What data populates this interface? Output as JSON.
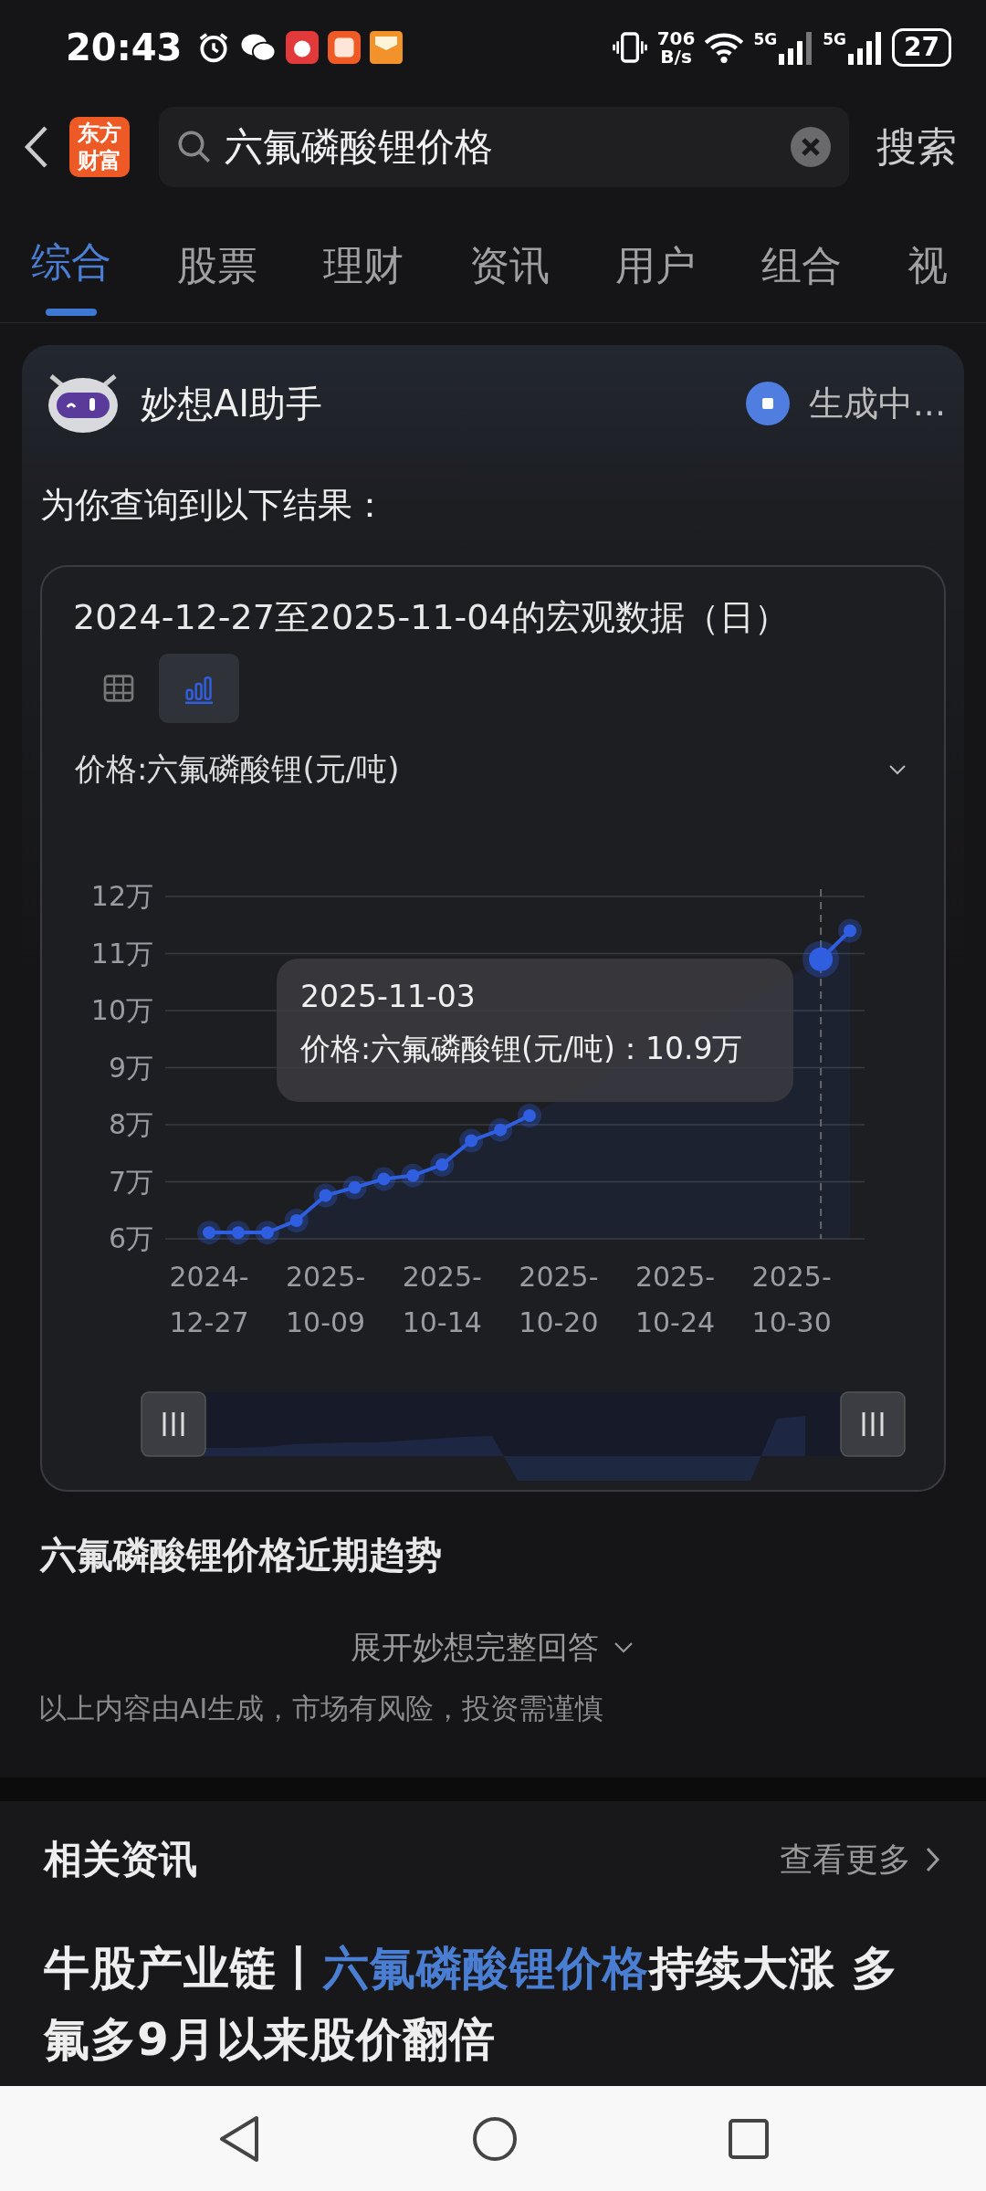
{
  "status_bar": {
    "time": "20:43",
    "net_speed": "706\nB/s",
    "signal_1": "5G",
    "signal_2": "5G",
    "battery": "27"
  },
  "header": {
    "logo": "东方财富",
    "search": {
      "value": "六氟磷酸锂价格"
    },
    "search_button": "搜索"
  },
  "tabs": [
    {
      "label": "综合",
      "selected": true
    },
    {
      "label": "股票",
      "selected": false
    },
    {
      "label": "理财",
      "selected": false
    },
    {
      "label": "资讯",
      "selected": false
    },
    {
      "label": "用户",
      "selected": false
    },
    {
      "label": "组合",
      "selected": false
    },
    {
      "label": "视",
      "selected": false
    }
  ],
  "ai_card": {
    "title": "妙想AI助手",
    "status": "生成中...",
    "intro": "为你查询到以下结果：",
    "data_card": {
      "title": "2024-12-27至2025-11-04的宏观数据（日）",
      "view_toggle": [
        {
          "kind": "table",
          "selected": false
        },
        {
          "kind": "chart",
          "selected": true
        }
      ],
      "tooltip": {
        "date": "2025-11-03",
        "label": "价格:六氟磷酸锂(元/吨)：",
        "value": "10.9万"
      },
      "chart_data": {
        "type": "area",
        "grid": true,
        "categories": [
          "2024-12-27",
          null,
          null,
          null,
          "2025-10-09",
          null,
          null,
          null,
          "2025-10-14",
          null,
          null,
          null,
          "2025-10-20",
          null,
          null,
          null,
          "2025-10-24",
          null,
          null,
          null,
          "2025-10-30",
          null,
          null
        ],
        "series": [
          {
            "name": "价格:六氟磷酸锂(元/吨)",
            "color": "#2f5fe0",
            "values": [
              6.11,
              6.11,
              6.11,
              6.32,
              6.76,
              6.9,
              7.05,
              7.11,
              7.3,
              7.72,
              7.91,
              8.16,
              null,
              null,
              null,
              null,
              null,
              null,
              null,
              null,
              null,
              10.9,
              11.4
            ]
          }
        ],
        "ylim": [
          6,
          12
        ],
        "yticks": [
          {
            "value": 6,
            "label": "6万"
          },
          {
            "value": 7,
            "label": "7万"
          },
          {
            "value": 8,
            "label": "8万"
          },
          {
            "value": 9,
            "label": "9万"
          },
          {
            "value": 10,
            "label": "10万"
          },
          {
            "value": 11,
            "label": "11万"
          },
          {
            "value": 12,
            "label": "12万"
          }
        ]
      }
    },
    "section_title": "六氟磷酸锂价格近期趋势",
    "expand": "展开妙想完整回答",
    "disclaimer": "以上内容由AI生成，市场有风险，投资需谨慎"
  },
  "news": {
    "title": "相关资讯",
    "more": "查看更多",
    "headline": [
      {
        "text": "牛股产业链丨",
        "highlight": false
      },
      {
        "text": "六氟磷酸锂价格",
        "highlight": true
      },
      {
        "text": "持续大涨 多氟多9月以来股价翻倍",
        "highlight": false
      }
    ]
  }
}
